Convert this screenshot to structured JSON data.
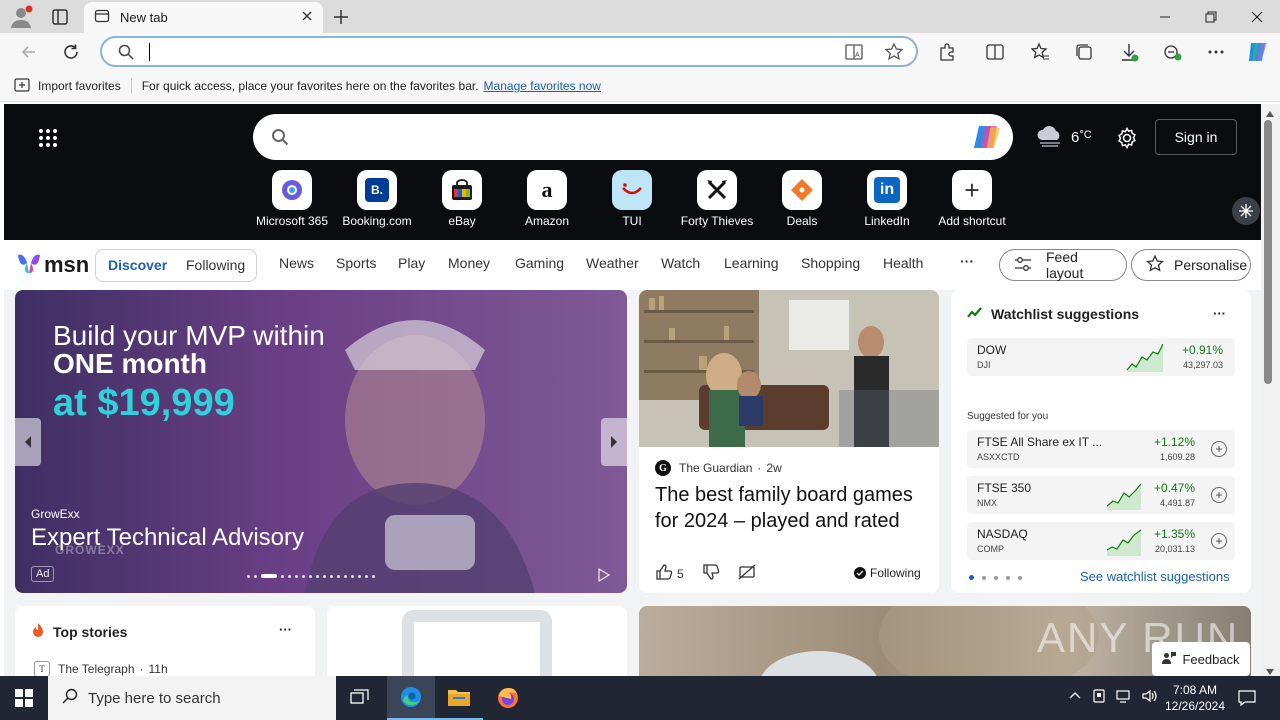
{
  "browser": {
    "tab_title": "New tab",
    "favorites_bar": {
      "import_label": "Import favorites",
      "hint": "For quick access, place your favorites here on the favorites bar.",
      "manage_link": "Manage favorites now"
    }
  },
  "msn": {
    "weather_temp": "6",
    "weather_unit": "°C",
    "sign_in": "Sign in",
    "shortcuts": [
      {
        "label": "Microsoft 365",
        "icon": "microsoft-365-icon"
      },
      {
        "label": "Booking.com",
        "icon": "booking-icon",
        "glyph": "B."
      },
      {
        "label": "eBay",
        "icon": "ebay-icon"
      },
      {
        "label": "Amazon",
        "icon": "amazon-icon",
        "glyph": "a"
      },
      {
        "label": "TUI",
        "icon": "tui-icon"
      },
      {
        "label": "Forty Thieves",
        "icon": "forty-thieves-icon"
      },
      {
        "label": "Deals",
        "icon": "deals-icon"
      },
      {
        "label": "LinkedIn",
        "icon": "linkedin-icon",
        "glyph": "in"
      },
      {
        "label": "Add shortcut",
        "icon": "plus-icon",
        "glyph": "+"
      }
    ],
    "logo_text": "msn",
    "feed_tabs": {
      "discover": "Discover",
      "following": "Following"
    },
    "nav": [
      "News",
      "Sports",
      "Play",
      "Money",
      "Gaming",
      "Weather",
      "Watch",
      "Learning",
      "Shopping",
      "Health"
    ],
    "more": "···",
    "feed_layout": "Feed layout",
    "personalise": "Personalise",
    "ad": {
      "headline_1": "Build your MVP within",
      "headline_2": "ONE month",
      "headline_3": "at $19,999",
      "sponsor": "GrowExx",
      "title": "Expert Technical Advisory",
      "badge": "Ad",
      "watermark": "GROWEXX"
    },
    "article": {
      "source": "The Guardian",
      "age": "2w",
      "title": "The best family board games for 2024 – played and rated",
      "likes": "5",
      "following": "Following"
    },
    "watchlist": {
      "title": "Watchlist suggestions",
      "more": "···",
      "main": {
        "symbol": "DOW",
        "exchange": "DJI",
        "change": "+0.91%",
        "price": "43,297.03"
      },
      "suggested_label": "Suggested for you",
      "items": [
        {
          "symbol": "FTSE All Share ex IT ...",
          "exchange": "ASXXCTD",
          "change": "+1.12%",
          "price": "1,609.28"
        },
        {
          "symbol": "FTSE 350",
          "exchange": "NMX",
          "change": "+0.47%",
          "price": "4,491.87"
        },
        {
          "symbol": "NASDAQ",
          "exchange": "COMP",
          "change": "+1.35%",
          "price": "20,031.13"
        }
      ],
      "see_link": "See watchlist suggestions",
      "positive_color": "#0f7b0f"
    },
    "top_stories": {
      "title": "Top stories",
      "more": "···",
      "source": "The Telegraph",
      "age": "11h"
    },
    "feedback": "Feedback",
    "watermark": "ANY RUN"
  },
  "taskbar": {
    "search_placeholder": "Type here to search",
    "time": "7:08 AM",
    "date": "12/26/2024"
  }
}
